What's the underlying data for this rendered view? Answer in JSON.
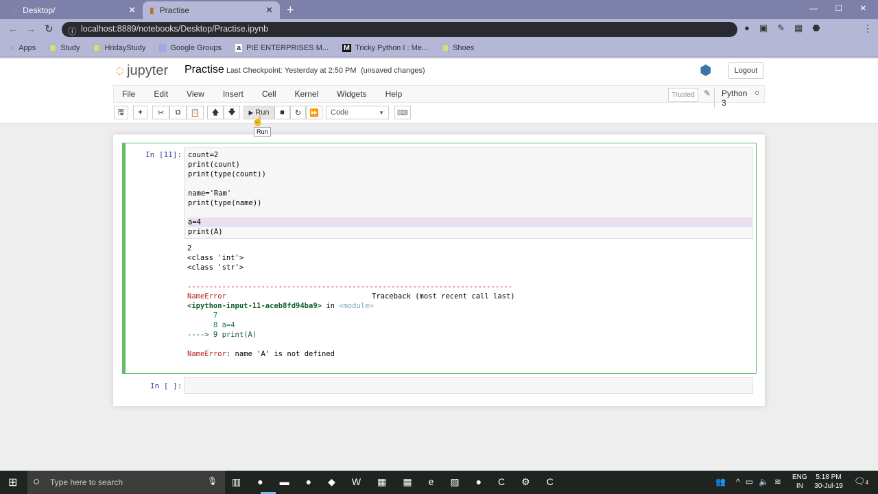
{
  "browser": {
    "tabs": [
      {
        "title": "Desktop/"
      },
      {
        "title": "Practise"
      }
    ],
    "url": "localhost:8889/notebooks/Desktop/Practise.ipynb",
    "bookmarks": [
      "Apps",
      "Study",
      "HridayStudy",
      "Google Groups",
      "PIE ENTERPRISES M...",
      "Tricky Python I : Me...",
      "Shoes"
    ]
  },
  "header": {
    "logo": "jupyter",
    "notebook_name": "Practise",
    "checkpoint": "Last Checkpoint: Yesterday at 2:50 PM",
    "unsaved": "(unsaved changes)",
    "logout": "Logout"
  },
  "menu": [
    "File",
    "Edit",
    "View",
    "Insert",
    "Cell",
    "Kernel",
    "Widgets",
    "Help"
  ],
  "status": {
    "trusted": "Trusted",
    "kernel": "Python 3"
  },
  "toolbar": {
    "run": "Run",
    "cell_type": "Code",
    "tooltip": "Run"
  },
  "cells": [
    {
      "prompt": "In [11]:",
      "code": [
        "count=2",
        "print(count)",
        "print(type(count))",
        "",
        "name='Ram'",
        "print(type(name))",
        "",
        "a=4",
        "print(A)"
      ],
      "output": [
        "2",
        "<class 'int'>",
        "<class 'str'>"
      ],
      "traceback": {
        "dashes": "---------------------------------------------------------------------------",
        "error": "NameError",
        "header": "Traceback (most recent call last)",
        "location": "<ipython-input-11-aceb8fd94ba9>",
        "in": " in ",
        "module": "<module>",
        "lines": [
          "      7",
          "      8 a=4",
          "----> 9 print(A)"
        ],
        "final_name": "NameError",
        "final_msg": ": name 'A' is not defined"
      }
    },
    {
      "prompt": "In [ ]:"
    }
  ],
  "taskbar": {
    "search": "Type here to search",
    "lang1": "ENG",
    "lang2": "IN",
    "time": "5:18 PM",
    "date": "30-Jul-19",
    "notifications": "4"
  }
}
